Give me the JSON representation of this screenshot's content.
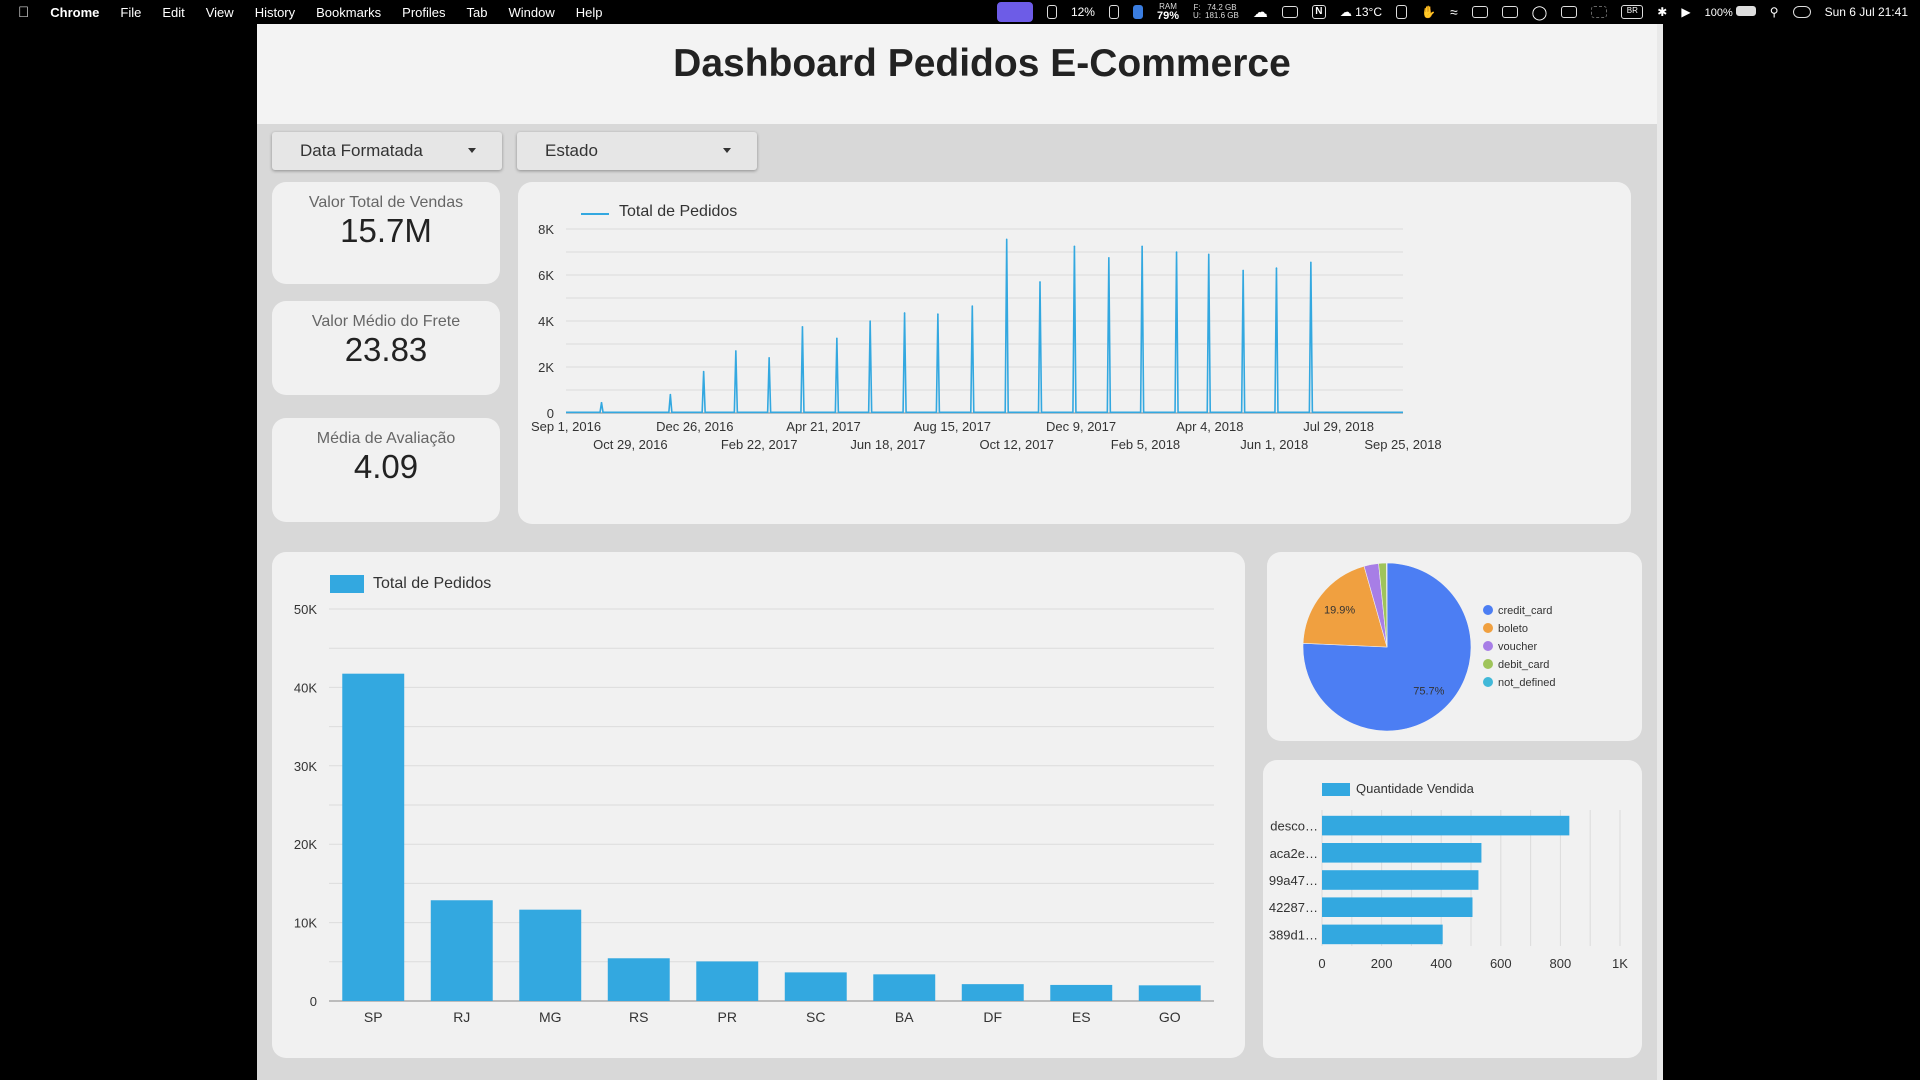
{
  "menubar": {
    "app_name": "Chrome",
    "menus": [
      "File",
      "Edit",
      "View",
      "History",
      "Bookmarks",
      "Profiles",
      "Tab",
      "Window",
      "Help"
    ],
    "status": {
      "cpu": "12%",
      "ram_label": "RAM",
      "ram": "79%",
      "disk_labels": "F:\nU:",
      "disk_free": "74.2 GB",
      "disk_used": "181.6 GB",
      "weather": "13°C",
      "input": "BR",
      "battery": "100%",
      "datetime": "Sun 6 Jul  21:41"
    }
  },
  "dashboard": {
    "title": "Dashboard Pedidos E-Commerce",
    "filters": [
      {
        "label": "Data Formatada"
      },
      {
        "label": "Estado"
      }
    ],
    "kpis": [
      {
        "label": "Valor Total de Vendas",
        "value": "15.7M"
      },
      {
        "label": "Valor Médio do Frete",
        "value": "23.83"
      },
      {
        "label": "Média de Avaliação",
        "value": "4.09"
      }
    ]
  },
  "colors": {
    "primary": "#33a8e0",
    "pie": [
      "#4c7ef3",
      "#f0a040",
      "#a77ee6",
      "#9fc45a",
      "#41b8d8"
    ]
  },
  "chart_data": [
    {
      "type": "line",
      "legend": "Total de Pedidos",
      "ylim": [
        0,
        8000
      ],
      "yticks": [
        {
          "v": 0,
          "label": "0"
        },
        {
          "v": 2000,
          "label": "2K"
        },
        {
          "v": 4000,
          "label": "4K"
        },
        {
          "v": 6000,
          "label": "6K"
        },
        {
          "v": 8000,
          "label": "8K"
        }
      ],
      "x_start": "2016-09-01",
      "x_end": "2018-09-25",
      "xticks_upper": [
        "Sep 1, 2016",
        "Dec 26, 2016",
        "Apr 21, 2017",
        "Aug 15, 2017",
        "Dec 9, 2017",
        "Apr 4, 2018",
        "Jul 29, 2018"
      ],
      "xticks_lower": [
        "Oct 29, 2016",
        "Feb 22, 2017",
        "Jun 18, 2017",
        "Oct 12, 2017",
        "Feb 5, 2018",
        "Jun 1, 2018",
        "Sep 25, 2018"
      ],
      "grid": true,
      "spikes": [
        {
          "date": "2016-10-03",
          "value": 450
        },
        {
          "date": "2016-12-04",
          "value": 800
        },
        {
          "date": "2017-01-03",
          "value": 1800
        },
        {
          "date": "2017-02-01",
          "value": 2700
        },
        {
          "date": "2017-03-03",
          "value": 2400
        },
        {
          "date": "2017-04-02",
          "value": 3750
        },
        {
          "date": "2017-05-03",
          "value": 3250
        },
        {
          "date": "2017-06-02",
          "value": 4000
        },
        {
          "date": "2017-07-03",
          "value": 4350
        },
        {
          "date": "2017-08-02",
          "value": 4300
        },
        {
          "date": "2017-09-02",
          "value": 4650
        },
        {
          "date": "2017-10-03",
          "value": 7550
        },
        {
          "date": "2017-11-02",
          "value": 5700
        },
        {
          "date": "2017-12-03",
          "value": 7250
        },
        {
          "date": "2018-01-03",
          "value": 6750
        },
        {
          "date": "2018-02-02",
          "value": 7250
        },
        {
          "date": "2018-03-05",
          "value": 7000
        },
        {
          "date": "2018-04-03",
          "value": 6900
        },
        {
          "date": "2018-05-04",
          "value": 6200
        },
        {
          "date": "2018-06-03",
          "value": 6300
        },
        {
          "date": "2018-07-04",
          "value": 6550
        }
      ]
    },
    {
      "type": "bar",
      "legend": "Total de Pedidos",
      "categories": [
        "SP",
        "RJ",
        "MG",
        "RS",
        "PR",
        "SC",
        "BA",
        "DF",
        "ES",
        "GO"
      ],
      "values": [
        41750,
        12850,
        11650,
        5450,
        5050,
        3650,
        3400,
        2150,
        2050,
        2000
      ],
      "ylim": [
        0,
        50000
      ],
      "yticks": [
        {
          "v": 0,
          "label": "0"
        },
        {
          "v": 10000,
          "label": "10K"
        },
        {
          "v": 20000,
          "label": "20K"
        },
        {
          "v": 30000,
          "label": "30K"
        },
        {
          "v": 40000,
          "label": "40K"
        },
        {
          "v": 50000,
          "label": "50K"
        }
      ],
      "grid": true
    },
    {
      "type": "pie",
      "slices": [
        {
          "name": "credit_card",
          "value": 75.7,
          "label": "75.7%"
        },
        {
          "name": "boleto",
          "value": 19.9,
          "label": "19.9%"
        },
        {
          "name": "voucher",
          "value": 2.8,
          "label": ""
        },
        {
          "name": "debit_card",
          "value": 1.5,
          "label": ""
        },
        {
          "name": "not_defined",
          "value": 0.1,
          "label": ""
        }
      ],
      "legend_position": "right"
    },
    {
      "type": "bar",
      "orientation": "horizontal",
      "legend": "Quantidade Vendida",
      "categories": [
        "desco…",
        "aca2e…",
        "99a47…",
        "42287…",
        "389d1…"
      ],
      "values": [
        830,
        535,
        525,
        505,
        405
      ],
      "xlim": [
        0,
        1000
      ],
      "xticks": [
        {
          "v": 0,
          "label": "0"
        },
        {
          "v": 200,
          "label": "200"
        },
        {
          "v": 400,
          "label": "400"
        },
        {
          "v": 600,
          "label": "600"
        },
        {
          "v": 800,
          "label": "800"
        },
        {
          "v": 1000,
          "label": "1K"
        }
      ],
      "grid": true
    }
  ]
}
